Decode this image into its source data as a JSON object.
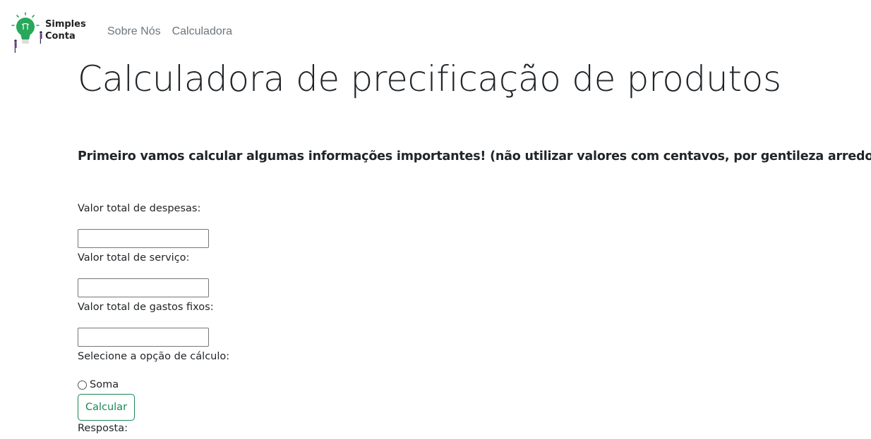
{
  "navbar": {
    "brand_line1": "Simples",
    "brand_line2": "Conta",
    "links": [
      "Sobre Nós",
      "Calculadora"
    ]
  },
  "main": {
    "title": "Calculadora de precificação de produtos",
    "subtitle": "Primeiro vamos calcular algumas informações importantes! (não utilizar valores com centavos, por gentileza arredondar)",
    "fields": [
      {
        "label": "Valor total de despesas:",
        "value": ""
      },
      {
        "label": "Valor total de serviço:",
        "value": ""
      },
      {
        "label": "Valor total de gastos fixos:",
        "value": ""
      }
    ],
    "option_label": "Selecione a opção de cálculo:",
    "radio_option": "Soma",
    "button_label": "Calcular",
    "response_label": "Resposta:"
  },
  "colors": {
    "accent": "#198754",
    "nav_link": "#6c757d",
    "text": "#212529"
  },
  "icons": {
    "logo": "lightbulb-logo-icon"
  }
}
